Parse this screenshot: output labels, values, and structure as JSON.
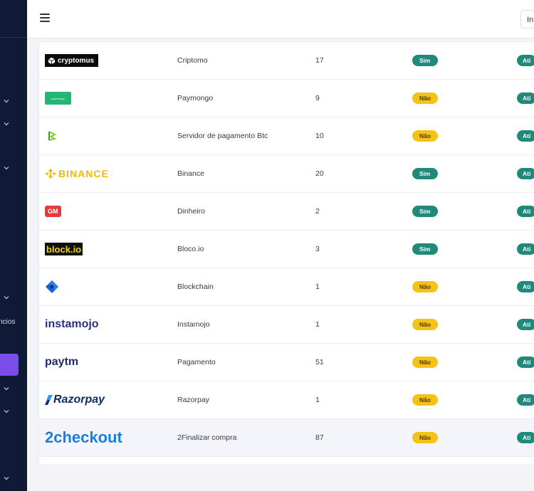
{
  "sidebar": {
    "partial_text": "ncios"
  },
  "topbar": {
    "input_value": "In"
  },
  "status_label": "Ati",
  "colors": {
    "sim": "#1f8a7a",
    "nao": "#f5c316",
    "sidebar": "#0f1a36",
    "accent": "#7a4de8"
  },
  "rows": [
    {
      "logo_text": "cryptomus",
      "name": "Criptomo",
      "count": "17",
      "badge": "Sim",
      "badge_type": "sim"
    },
    {
      "logo_text": "paymongo",
      "name": "Paymongo",
      "count": "9",
      "badge": "Não",
      "badge_type": "nao"
    },
    {
      "logo_text": "",
      "name": "Servidor de pagamento Btc",
      "count": "10",
      "badge": "Não",
      "badge_type": "nao"
    },
    {
      "logo_text": "BINANCE",
      "name": "Binance",
      "count": "20",
      "badge": "Sim",
      "badge_type": "sim"
    },
    {
      "logo_text": "GM",
      "name": "Dinheiro",
      "count": "2",
      "badge": "Sim",
      "badge_type": "sim"
    },
    {
      "logo_text": "block.io",
      "name": "Bloco.io",
      "count": "3",
      "badge": "Sim",
      "badge_type": "sim"
    },
    {
      "logo_text": "",
      "name": "Blockchain",
      "count": "1",
      "badge": "Não",
      "badge_type": "nao"
    },
    {
      "logo_text": "instamojo",
      "name": "Instamojo",
      "count": "1",
      "badge": "Não",
      "badge_type": "nao"
    },
    {
      "logo_text": "paytm",
      "name": "Pagamento",
      "count": "51",
      "badge": "Não",
      "badge_type": "nao"
    },
    {
      "logo_text": "Razorpay",
      "name": "Razorpay",
      "count": "1",
      "badge": "Não",
      "badge_type": "nao"
    },
    {
      "logo_text": "2checkout",
      "name": "2Finalizar compra",
      "count": "87",
      "badge": "Não",
      "badge_type": "nao"
    }
  ]
}
